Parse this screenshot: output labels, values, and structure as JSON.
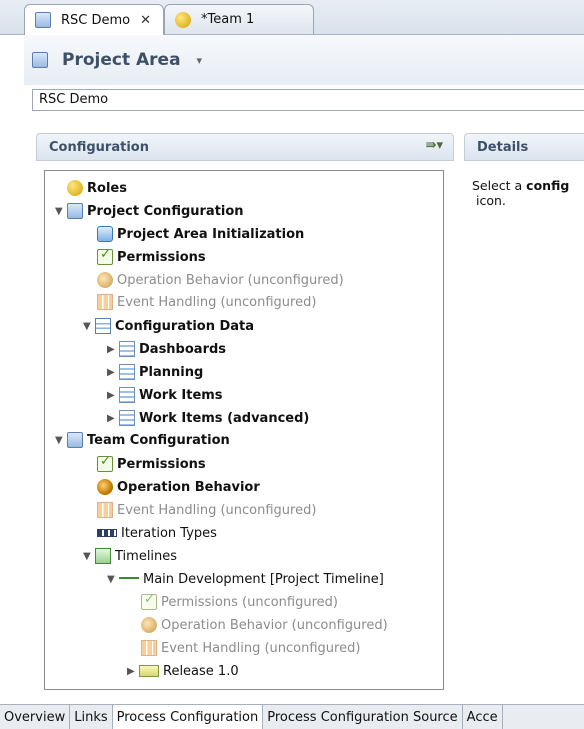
{
  "tabs": [
    {
      "label": "RSC Demo",
      "icon": "project-area-icon",
      "active": true
    },
    {
      "label": "*Team 1",
      "icon": "team-area-icon",
      "active": false
    }
  ],
  "header": {
    "title": "Project Area",
    "name_value": "RSC Demo"
  },
  "config_section": {
    "title": "Configuration"
  },
  "details_section": {
    "title": "Details",
    "text_part1": "Select a ",
    "text_bold": "config",
    "text_part2": "icon."
  },
  "tree": [
    {
      "label": "Roles"
    },
    {
      "label": "Project Configuration"
    },
    {
      "label": "Project Area Initialization"
    },
    {
      "label": "Permissions"
    },
    {
      "label": "Operation Behavior (unconfigured)"
    },
    {
      "label": "Event Handling (unconfigured)"
    },
    {
      "label": "Configuration Data"
    },
    {
      "label": "Dashboards"
    },
    {
      "label": "Planning"
    },
    {
      "label": "Work Items"
    },
    {
      "label": "Work Items (advanced)"
    },
    {
      "label": "Team Configuration"
    },
    {
      "label": "Permissions"
    },
    {
      "label": "Operation Behavior"
    },
    {
      "label": "Event Handling (unconfigured)"
    },
    {
      "label": "Iteration Types"
    },
    {
      "label": "Timelines"
    },
    {
      "label": "Main Development [Project Timeline]"
    },
    {
      "label": "Permissions (unconfigured)"
    },
    {
      "label": "Operation Behavior (unconfigured)"
    },
    {
      "label": "Event Handling (unconfigured)"
    },
    {
      "label": "Release 1.0"
    }
  ],
  "bottom_tabs": [
    {
      "label": "Overview",
      "active": false
    },
    {
      "label": "Links",
      "active": false
    },
    {
      "label": "Process Configuration",
      "active": true
    },
    {
      "label": "Process Configuration Source",
      "active": false
    },
    {
      "label": "Acce",
      "active": false
    }
  ]
}
